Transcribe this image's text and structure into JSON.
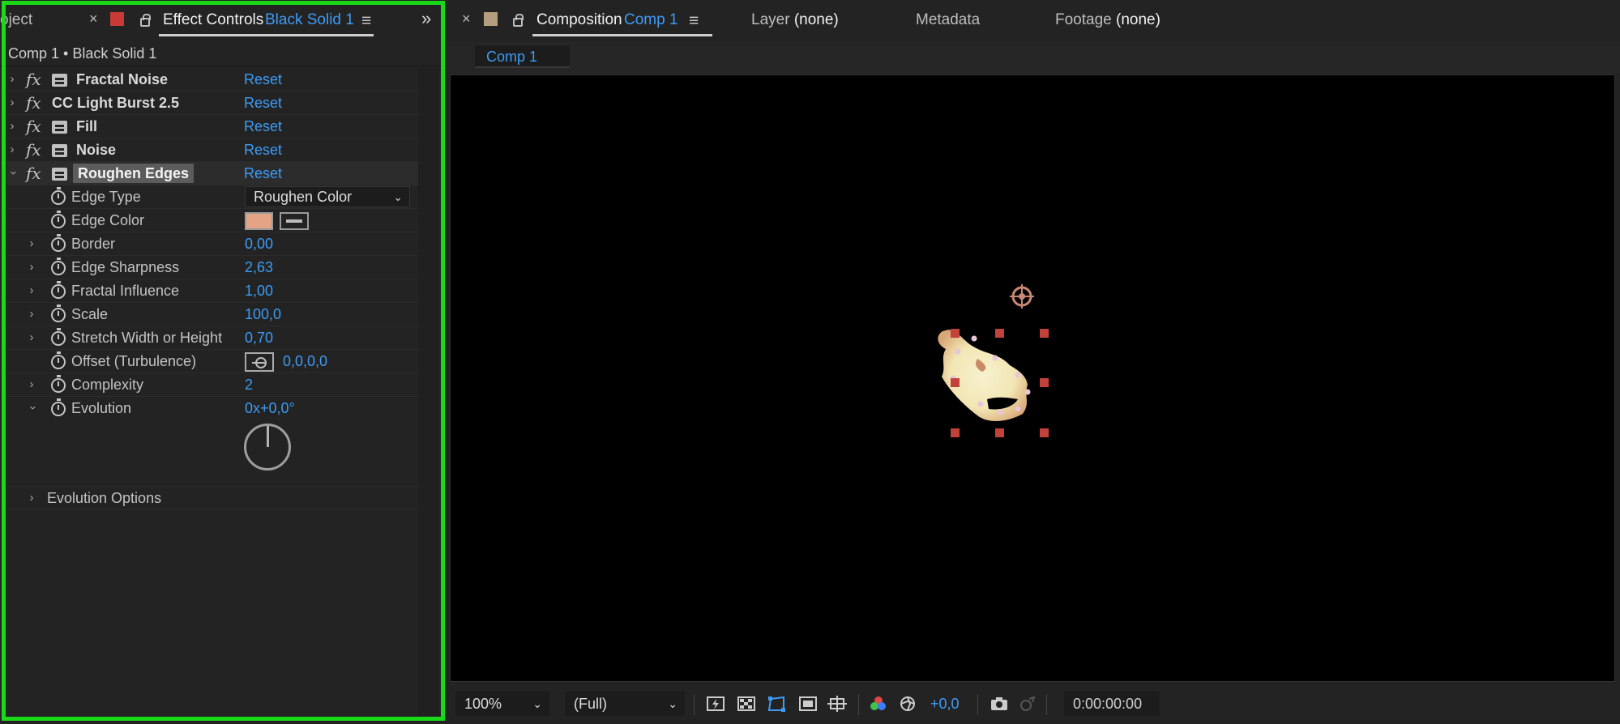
{
  "left_panel": {
    "partial_tab": "oject",
    "close_glyph": "×",
    "tab_title": "Effect Controls",
    "tab_layer": "Black Solid 1",
    "menu_glyph": "≡",
    "overflow_glyph": "»",
    "breadcrumb": "Comp 1 • Black Solid 1",
    "swatch_color": "#c93a36",
    "effects": [
      {
        "name": "Fractal Noise",
        "reset": "Reset",
        "badge": true
      },
      {
        "name": "CC Light Burst 2.5",
        "reset": "Reset",
        "badge": false
      },
      {
        "name": "Fill",
        "reset": "Reset",
        "badge": true
      },
      {
        "name": "Noise",
        "reset": "Reset",
        "badge": true
      },
      {
        "name": "Roughen Edges",
        "reset": "Reset",
        "badge": true
      }
    ],
    "properties": {
      "edge_type": {
        "label": "Edge Type",
        "value": "Roughen Color"
      },
      "edge_color": {
        "label": "Edge Color",
        "color": "#e3a384"
      },
      "border": {
        "label": "Border",
        "value": "0,00"
      },
      "edge_sharpness": {
        "label": "Edge Sharpness",
        "value": "2,63"
      },
      "fractal_influence": {
        "label": "Fractal Influence",
        "value": "1,00"
      },
      "scale": {
        "label": "Scale",
        "value": "100,0"
      },
      "stretch": {
        "label": "Stretch Width or Height",
        "value": "0,70"
      },
      "offset": {
        "label": "Offset (Turbulence)",
        "value": "0,0,0,0"
      },
      "complexity": {
        "label": "Complexity",
        "value": "2"
      },
      "evolution": {
        "label": "Evolution",
        "value": "0x+0,0°"
      },
      "evolution_options": {
        "label": "Evolution Options"
      }
    }
  },
  "right_panel": {
    "composition_tab": {
      "label": "Composition",
      "name": "Comp 1",
      "swatch_color": "#b59e7e"
    },
    "layer_tab": {
      "label": "Layer",
      "value": "(none)"
    },
    "metadata_tab": {
      "label": "Metadata"
    },
    "footage_tab": {
      "label": "Footage",
      "value": "(none)"
    },
    "comp_button": "Comp 1",
    "footer": {
      "zoom": "100%",
      "resolution": "(Full)",
      "exposure": "+0,0",
      "timecode": "0:00:00:00"
    }
  }
}
